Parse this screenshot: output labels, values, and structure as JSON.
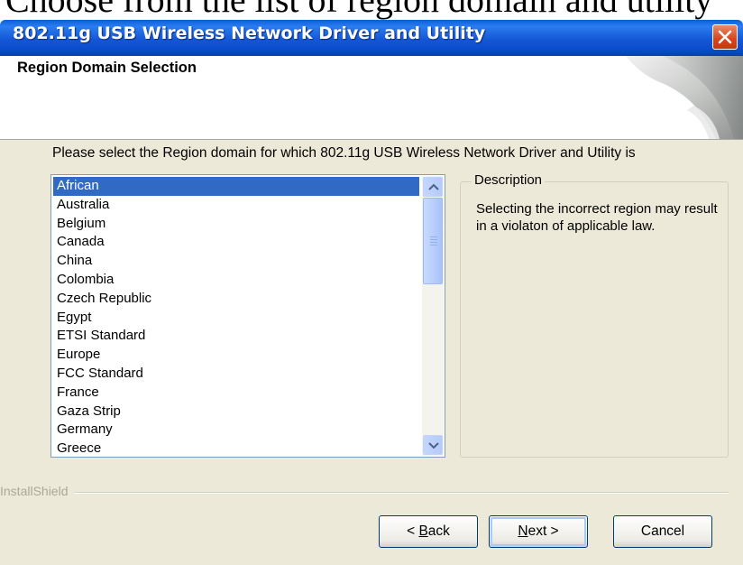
{
  "page_caption": "Choose from the list of region domain and utility",
  "window": {
    "title": "802.11g USB Wireless Network Driver and Utility",
    "header_title": "Region Domain Selection"
  },
  "prompt": "Please select the Region domain for which 802.11g USB Wireless Network Driver and Utility is",
  "region_list": {
    "selected": "African",
    "items": [
      "African",
      "Australia",
      "Belgium",
      "Canada",
      "China",
      "Colombia",
      "Czech Republic",
      "Egypt",
      "ETSI Standard",
      "Europe",
      "FCC Standard",
      "France",
      "Gaza Strip",
      "Germany",
      "Greece"
    ]
  },
  "description": {
    "legend": "Description",
    "text": "Selecting the incorrect region may result in a violaton of applicable law."
  },
  "installshield_label": "InstallShield",
  "buttons": {
    "back_prefix": "< ",
    "back_mnemonic": "B",
    "back_rest": "ack",
    "next_mnemonic": "N",
    "next_rest": "ext >",
    "cancel": "Cancel"
  },
  "colors": {
    "titlebar": "#0a4bc8",
    "selection": "#316ac5",
    "dialog_bg": "#ece9d8",
    "close_button": "#d8441c"
  },
  "icons": [
    "close-icon",
    "scroll-up-icon",
    "scroll-down-icon"
  ]
}
